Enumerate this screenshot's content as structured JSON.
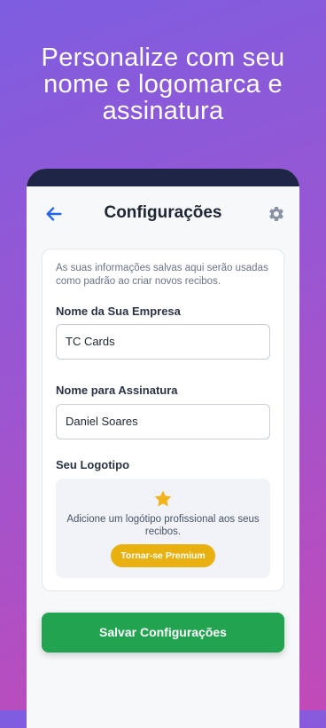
{
  "headline": {
    "line1": "Personalize com seu",
    "line2": "nome e logomarca e",
    "line3": "assinatura"
  },
  "appbar": {
    "title": "Configurações",
    "back_icon": "arrow-left-icon",
    "settings_icon": "gear-icon"
  },
  "form": {
    "description": "As suas informações salvas aqui serão usadas como padrão ao criar novos recibos.",
    "company": {
      "label": "Nome da Sua Empresa",
      "value": "TC Cards"
    },
    "signature": {
      "label": "Nome para Assinatura",
      "value": "Daniel Soares"
    },
    "logo": {
      "label": "Seu Logotipo",
      "icon": "star-icon",
      "text": "Adicione um logótipo profissional aos seus recibos.",
      "premium_label": "Tornar-se Premium"
    }
  },
  "save_label": "Salvar Configurações",
  "colors": {
    "accent": "#2563eb",
    "save": "#21a34f",
    "premium": "#e8b10f",
    "star": "#f2b31b",
    "notch": "#1f2547"
  }
}
